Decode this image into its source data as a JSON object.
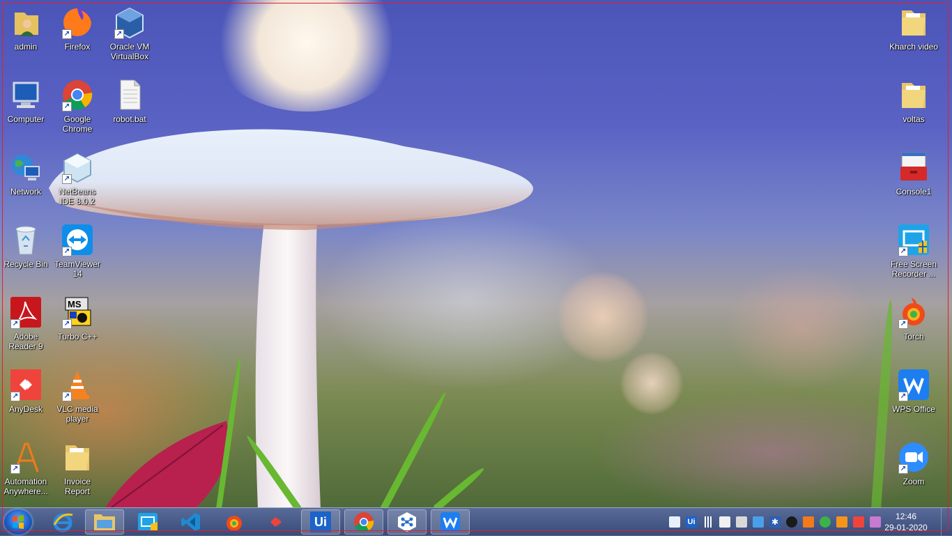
{
  "desktop": {
    "left_icons": [
      {
        "label": "admin",
        "icon": "user-folder-icon"
      },
      {
        "label": "Firefox",
        "icon": "firefox-icon"
      },
      {
        "label": "Oracle VM VirtualBox",
        "icon": "virtualbox-icon"
      },
      {
        "label": "Computer",
        "icon": "computer-icon"
      },
      {
        "label": "Google Chrome",
        "icon": "chrome-icon"
      },
      {
        "label": "robot.bat",
        "icon": "bat-file-icon"
      },
      {
        "label": "Network",
        "icon": "network-icon"
      },
      {
        "label": "NetBeans IDE 8.0.2",
        "icon": "netbeans-icon"
      },
      {
        "label": "Recycle Bin",
        "icon": "recycle-bin-icon"
      },
      {
        "label": "TeamViewer 14",
        "icon": "teamviewer-icon"
      },
      {
        "label": "Adobe Reader 9",
        "icon": "adobe-reader-icon"
      },
      {
        "label": "Turbo C++",
        "icon": "turbo-cpp-icon"
      },
      {
        "label": "AnyDesk",
        "icon": "anydesk-icon"
      },
      {
        "label": "VLC media player",
        "icon": "vlc-icon"
      },
      {
        "label": "Automation Anywhere...",
        "icon": "automation-anywhere-icon"
      },
      {
        "label": "Invoice Report",
        "icon": "folder-icon"
      }
    ],
    "right_icons": [
      {
        "label": "Kharch video",
        "icon": "folder-icon"
      },
      {
        "label": "voltas",
        "icon": "folder-icon"
      },
      {
        "label": "Console1",
        "icon": "console-toolbox-icon"
      },
      {
        "label": "Free Screen Recorder ...",
        "icon": "screen-recorder-icon"
      },
      {
        "label": "Torch",
        "icon": "torch-browser-icon"
      },
      {
        "label": "WPS Office",
        "icon": "wps-office-icon"
      },
      {
        "label": "Zoom",
        "icon": "zoom-icon"
      }
    ]
  },
  "taskbar": {
    "start_icon": "windows-start-icon",
    "pinned": [
      {
        "name": "internet-explorer-icon",
        "active": false
      },
      {
        "name": "file-explorer-icon",
        "active": true
      },
      {
        "name": "screen-recorder-icon",
        "active": false
      },
      {
        "name": "vscode-icon",
        "active": false
      },
      {
        "name": "torch-browser-icon",
        "active": false
      },
      {
        "name": "anydesk-icon",
        "active": false
      },
      {
        "name": "uipath-icon",
        "active": true,
        "text": "Ui"
      },
      {
        "name": "chrome-icon",
        "active": true
      },
      {
        "name": "network-hub-icon",
        "active": true
      },
      {
        "name": "wps-office-icon",
        "active": true
      }
    ],
    "tray": [
      "cloud-icon",
      "uipath-tray-icon",
      "signal-icon",
      "flag-icon",
      "device-icon",
      "monitor-icon",
      "bluetooth-icon",
      "security-icon",
      "avast-icon",
      "green-shield-icon",
      "orange-app-icon",
      "anydesk-tray-icon",
      "pink-app-icon"
    ],
    "clock": {
      "time": "12:46",
      "date": "29-01-2020"
    }
  },
  "colors": {
    "border": "#e0202a",
    "taskbar": "#2c4a86"
  }
}
